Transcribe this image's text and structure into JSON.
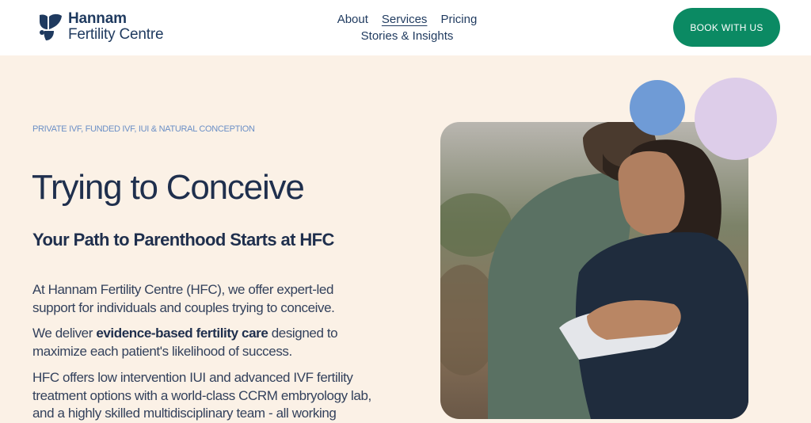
{
  "header": {
    "logo": {
      "line1": "Hannam",
      "line2": "Fertility Centre",
      "icon": "bird-icon"
    },
    "nav": {
      "about": "About",
      "services": "Services",
      "pricing": "Pricing",
      "stories": "Stories & Insights",
      "active": "Services"
    },
    "cta": "BOOK WITH US"
  },
  "hero": {
    "eyebrow": "PRIVATE IVF, FUNDED IVF, IUI & NATURAL CONCEPTION",
    "title": "Trying to Conceive",
    "subtitle": "Your Path to Parenthood Starts at HFC",
    "paragraph1": "At Hannam Fertility Centre (HFC), we offer expert-led support for individuals and couples trying to conceive.",
    "paragraph2_before": "We deliver ",
    "paragraph2_bold": "evidence-based fertility care",
    "paragraph2_after": " designed to maximize each patient's likelihood of success.",
    "paragraph3": "HFC offers low intervention IUI and advanced IVF fertility treatment options with a world-class CCRM embryology lab, and a highly skilled multidisciplinary team - all working"
  },
  "colors": {
    "background": "#fbf1e6",
    "header": "#ffffff",
    "brand_navy": "#1f3a5f",
    "cta_green": "#0b8a63",
    "accent_blue": "#6f9bd6",
    "accent_lilac": "#ddcde9",
    "eyebrow_blue": "#6b8fc6"
  }
}
